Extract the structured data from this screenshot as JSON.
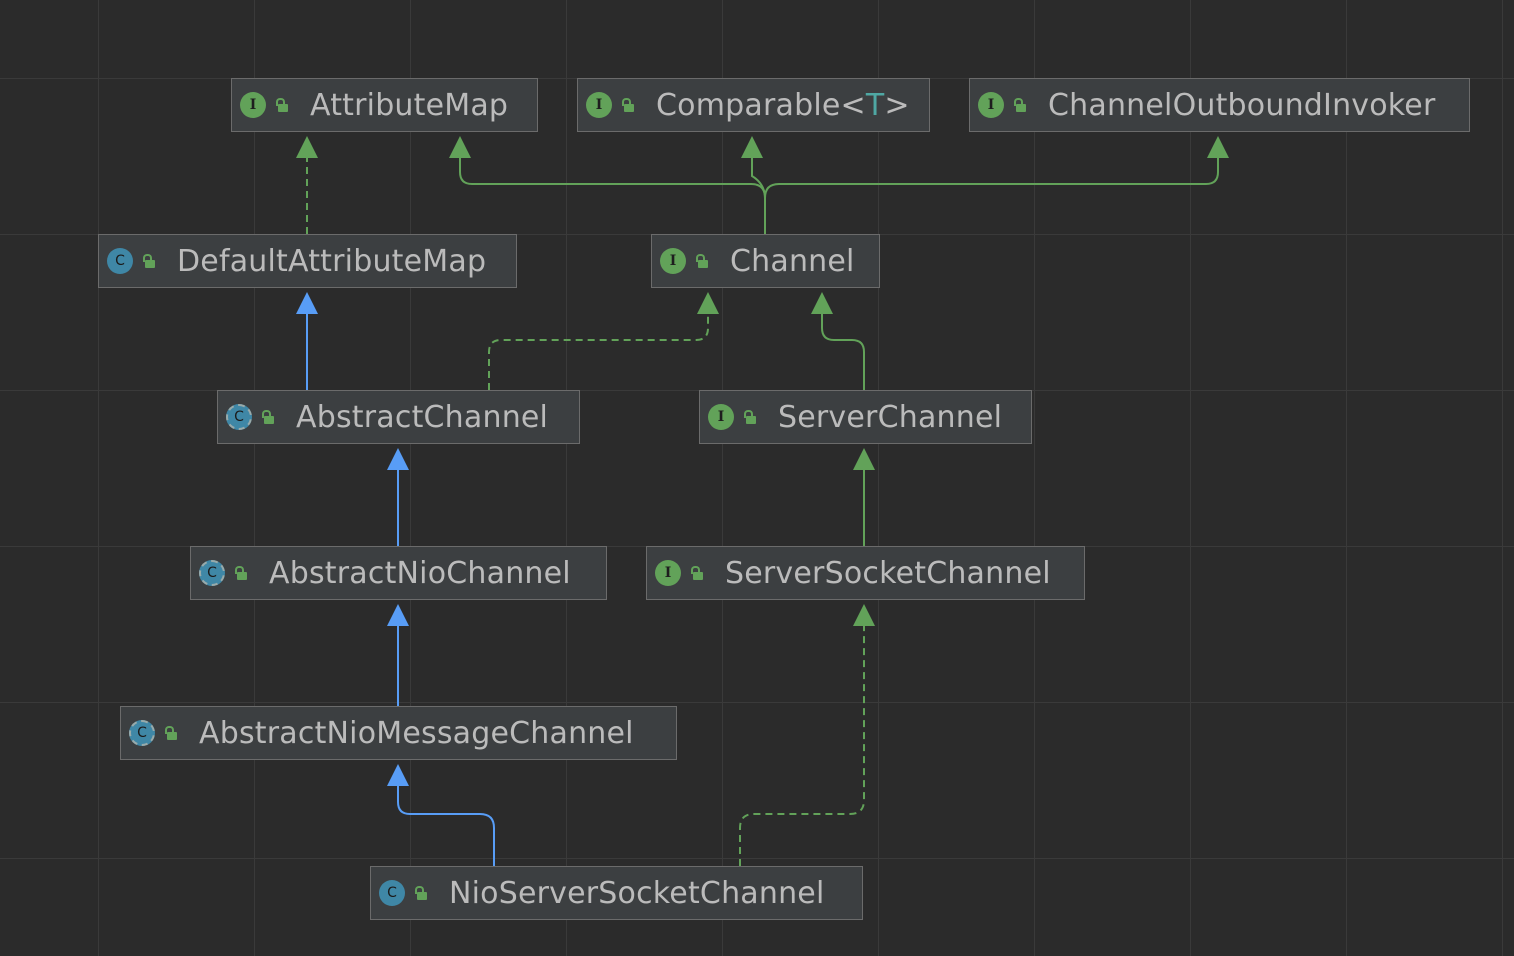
{
  "colors": {
    "background": "#2b2b2b",
    "node_fill": "#3c3f41",
    "node_border": "#6b6b6b",
    "interface_badge": "#62a259",
    "class_badge": "#3f87a6",
    "implements_edge": "#62a259",
    "extends_edge": "#589df6",
    "text": "#bbbbbb"
  },
  "nodes": {
    "attribute_map": {
      "label": "AttributeMap",
      "kind": "interface",
      "badge": "I"
    },
    "comparable": {
      "label_prefix": "Comparable<",
      "type_param": "T",
      "label_suffix": ">",
      "kind": "interface",
      "badge": "I"
    },
    "channel_outbound_invoker": {
      "label": "ChannelOutboundInvoker",
      "kind": "interface",
      "badge": "I"
    },
    "default_attribute_map": {
      "label": "DefaultAttributeMap",
      "kind": "class",
      "badge": "C"
    },
    "channel": {
      "label": "Channel",
      "kind": "interface",
      "badge": "I"
    },
    "abstract_channel": {
      "label": "AbstractChannel",
      "kind": "abstract-class",
      "badge": "C"
    },
    "server_channel": {
      "label": "ServerChannel",
      "kind": "interface",
      "badge": "I"
    },
    "abstract_nio_channel": {
      "label": "AbstractNioChannel",
      "kind": "abstract-class",
      "badge": "C"
    },
    "server_socket_channel": {
      "label": "ServerSocketChannel",
      "kind": "interface",
      "badge": "I"
    },
    "abstract_nio_message_channel": {
      "label": "AbstractNioMessageChannel",
      "kind": "abstract-class",
      "badge": "C"
    },
    "nio_server_socket_channel": {
      "label": "NioServerSocketChannel",
      "kind": "class",
      "badge": "C"
    }
  },
  "edges": [
    {
      "from": "default_attribute_map",
      "to": "attribute_map",
      "type": "implements"
    },
    {
      "from": "channel",
      "to": "attribute_map",
      "type": "extends-interface"
    },
    {
      "from": "channel",
      "to": "comparable",
      "type": "extends-interface"
    },
    {
      "from": "channel",
      "to": "channel_outbound_invoker",
      "type": "extends-interface"
    },
    {
      "from": "abstract_channel",
      "to": "default_attribute_map",
      "type": "extends"
    },
    {
      "from": "abstract_channel",
      "to": "channel",
      "type": "implements"
    },
    {
      "from": "server_channel",
      "to": "channel",
      "type": "extends-interface"
    },
    {
      "from": "abstract_nio_channel",
      "to": "abstract_channel",
      "type": "extends"
    },
    {
      "from": "server_socket_channel",
      "to": "server_channel",
      "type": "extends-interface"
    },
    {
      "from": "abstract_nio_message_channel",
      "to": "abstract_nio_channel",
      "type": "extends"
    },
    {
      "from": "nio_server_socket_channel",
      "to": "abstract_nio_message_channel",
      "type": "extends"
    },
    {
      "from": "nio_server_socket_channel",
      "to": "server_socket_channel",
      "type": "implements"
    }
  ]
}
